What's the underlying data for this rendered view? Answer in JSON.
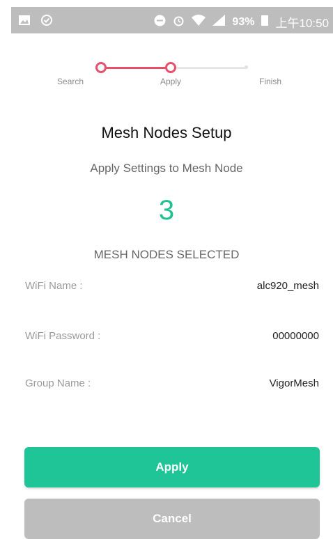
{
  "status_bar": {
    "battery": "93%",
    "time": "上午10:50"
  },
  "stepper": {
    "steps": [
      "Search",
      "Apply",
      "Finish"
    ]
  },
  "header": {
    "title": "Mesh Nodes Setup",
    "subtitle": "Apply Settings to Mesh Node"
  },
  "selection": {
    "count": "3",
    "label": "MESH NODES SELECTED"
  },
  "settings": [
    {
      "label": "WiFi Name :",
      "value": "alc920_mesh"
    },
    {
      "label": "WiFi Password :",
      "value": "00000000"
    },
    {
      "label": "Group Name :",
      "value": "VigorMesh"
    }
  ],
  "buttons": {
    "apply": "Apply",
    "cancel": "Cancel"
  },
  "colors": {
    "accent": "#1fc497",
    "stepper_active": "#e8506a"
  }
}
